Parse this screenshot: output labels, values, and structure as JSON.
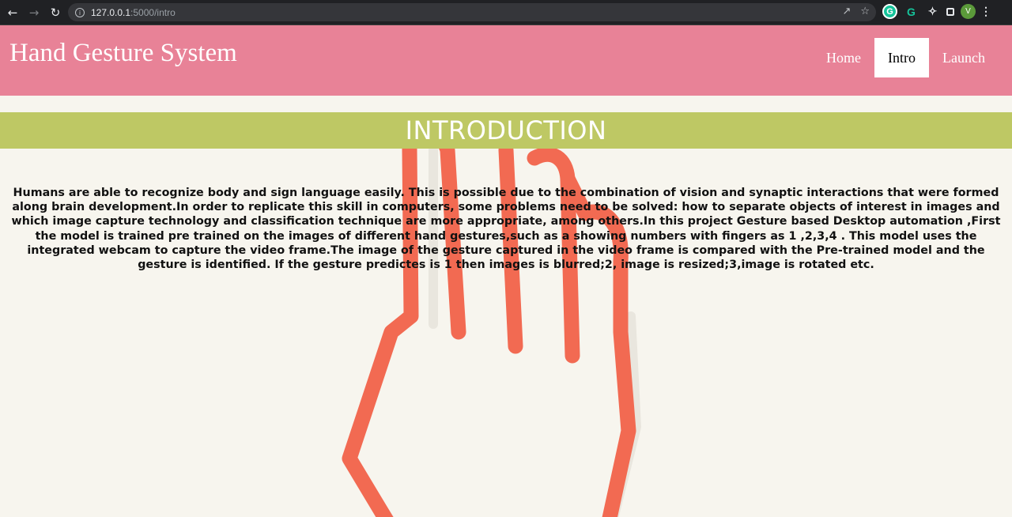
{
  "browser": {
    "url_host": "127.0.0.1",
    "url_rest": ":5000/intro",
    "profile_initial": "V"
  },
  "header": {
    "brand": "Hand Gesture System",
    "nav": [
      {
        "label": "Home",
        "active": false
      },
      {
        "label": "Intro",
        "active": true
      },
      {
        "label": "Launch",
        "active": false
      }
    ]
  },
  "banner": {
    "title": "INTRODUCTION"
  },
  "intro": {
    "text": "Humans are able to recognize body and sign language easily. This is possible due to the combination of vision and synaptic interactions that were formed along brain development.In order to replicate this skill in computers, some problems need to be solved: how to separate objects of interest in images and which image capture technology and classification technique are more appropriate, among others.In this project Gesture based Desktop automation ,First the model is trained pre trained on the images of different hand gestures,such as a showing numbers with fingers as 1 ,2,3,4 . This model uses the integrated webcam to capture the video frame.The image of the gesture captured in the video frame is compared with the Pre-trained model and the gesture is identified. If the gesture predictes is 1 then images is blurred;2, image is resized;3,image is rotated etc."
  },
  "colors": {
    "header": "#e88297",
    "banner": "#bec864",
    "hand": "#f26a52",
    "background": "#f7f5ee"
  },
  "icons": {
    "back": "arrow-left-icon",
    "forward": "arrow-right-icon",
    "reload": "reload-icon",
    "info": "info-icon",
    "share": "share-icon",
    "bookmark": "star-icon",
    "extensions": "puzzle-icon",
    "menu": "kebab-menu-icon"
  }
}
